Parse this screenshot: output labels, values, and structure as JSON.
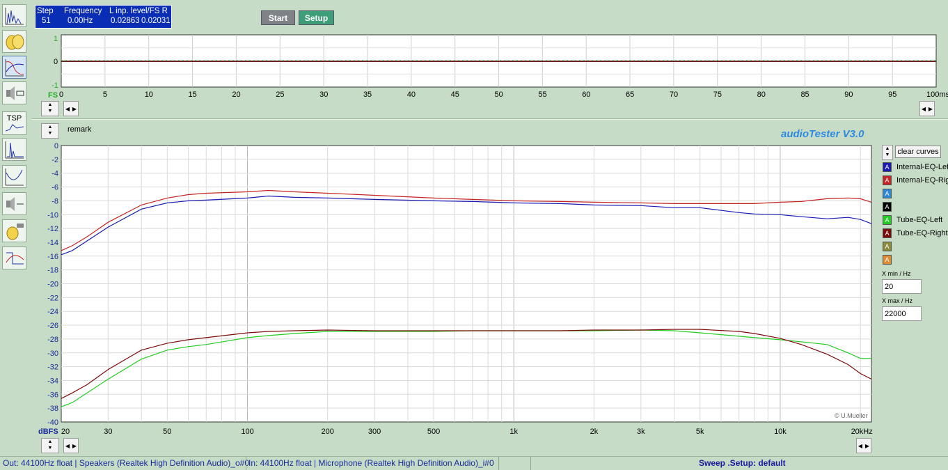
{
  "app": {
    "name": "audioTester",
    "version_label": "audioTester  V3.0",
    "copyright": "© U.Mueller"
  },
  "toolbar": {
    "tsp_label": "TSP",
    "icons": [
      "spectrum-icon",
      "hands-icon",
      "frequency-response-icon",
      "signal-generator-icon",
      "tsp-icon",
      "impulse-icon",
      "impedance-icon",
      "thd-icon",
      "distortion-icon",
      "filter-response-icon"
    ]
  },
  "status_box": {
    "step_label": "Step",
    "step_value": "51",
    "frequency_label": "Frequency",
    "frequency_value": "0.00Hz",
    "level_label": "L  inp. level/FS  R",
    "level_left": "0.02863",
    "level_right": "0.02031"
  },
  "buttons": {
    "start": "Start",
    "setup": "Setup"
  },
  "top_plot": {
    "y_ticks": [
      "1",
      "0",
      "-1"
    ],
    "y_unit": "FS",
    "x_ticks": [
      "0",
      "5",
      "10",
      "15",
      "20",
      "25",
      "30",
      "35",
      "40",
      "45",
      "50",
      "55",
      "60",
      "65",
      "70",
      "75",
      "80",
      "85",
      "90",
      "95",
      "100ms"
    ]
  },
  "remark_label": "remark",
  "main_plot": {
    "y_unit": "dBFS",
    "y_ticks": [
      "0",
      "-2",
      "-4",
      "-6",
      "-8",
      "-10",
      "-12",
      "-14",
      "-16",
      "-18",
      "-20",
      "-22",
      "-24",
      "-26",
      "-28",
      "-30",
      "-32",
      "-34",
      "-36",
      "-38",
      "-40"
    ],
    "x_ticks": [
      "20",
      "30",
      "50",
      "100",
      "200",
      "300",
      "500",
      "1k",
      "2k",
      "3k",
      "5k",
      "10k",
      "20kHz"
    ]
  },
  "legend": {
    "clear_curves": "clear curves",
    "swatch_glyph": "A",
    "curves": [
      {
        "name": "Internal-EQ-Left",
        "color": "#1b1bb4"
      },
      {
        "name": "Internal-EQ-Right",
        "color": "#c42424"
      },
      {
        "name": "",
        "color": "#2e86d6"
      },
      {
        "name": "",
        "color": "#000000"
      },
      {
        "name": "Tube-EQ-Left",
        "color": "#22cc22"
      },
      {
        "name": "Tube-EQ-Right",
        "color": "#7a0a0a"
      },
      {
        "name": "",
        "color": "#8a8a3a"
      },
      {
        "name": "",
        "color": "#e08a30"
      }
    ],
    "xmin_label": "X min / Hz",
    "xmin_value": "20",
    "xmax_label": "X max / Hz",
    "xmax_value": "22000"
  },
  "chart_data": {
    "type": "line",
    "x_scale": "log",
    "xlim": [
      20,
      22000
    ],
    "ylim": [
      -40,
      0
    ],
    "xlabel": "",
    "ylabel": "dBFS",
    "grid": true,
    "x": [
      20,
      22,
      25,
      30,
      40,
      50,
      60,
      70,
      100,
      120,
      150,
      200,
      300,
      500,
      700,
      1000,
      1500,
      2000,
      3000,
      4000,
      5000,
      7000,
      8000,
      10000,
      12000,
      15000,
      18000,
      20000,
      22000
    ],
    "series": [
      {
        "name": "Internal-EQ-Left",
        "color": "#1b1bb4",
        "values": [
          -15.8,
          -15.2,
          -13.8,
          -11.8,
          -9.2,
          -8.3,
          -8.0,
          -7.9,
          -7.6,
          -7.3,
          -7.5,
          -7.6,
          -7.8,
          -8.0,
          -8.1,
          -8.3,
          -8.4,
          -8.6,
          -8.7,
          -9.0,
          -9.0,
          -9.7,
          -9.9,
          -10.0,
          -10.3,
          -10.6,
          -10.4,
          -10.7,
          -11.3
        ]
      },
      {
        "name": "Internal-EQ-Right",
        "color": "#c42424",
        "values": [
          -15.2,
          -14.5,
          -13.2,
          -11.1,
          -8.6,
          -7.6,
          -7.1,
          -6.9,
          -6.7,
          -6.5,
          -6.7,
          -6.9,
          -7.2,
          -7.6,
          -7.8,
          -8.0,
          -8.1,
          -8.2,
          -8.3,
          -8.4,
          -8.4,
          -8.4,
          -8.4,
          -8.2,
          -8.1,
          -7.7,
          -7.6,
          -7.7,
          -8.2
        ]
      },
      {
        "name": "Tube-EQ-Left",
        "color": "#22cc22",
        "values": [
          -37.8,
          -37.2,
          -35.8,
          -33.8,
          -30.9,
          -29.6,
          -29.1,
          -28.8,
          -27.8,
          -27.5,
          -27.2,
          -26.9,
          -26.9,
          -26.9,
          -26.8,
          -26.8,
          -26.8,
          -26.8,
          -26.7,
          -26.8,
          -27.1,
          -27.6,
          -27.8,
          -28.1,
          -28.4,
          -28.8,
          -30.0,
          -30.8,
          -30.8
        ]
      },
      {
        "name": "Tube-EQ-Right",
        "color": "#7a0a0a",
        "values": [
          -36.6,
          -35.8,
          -34.6,
          -32.4,
          -29.6,
          -28.6,
          -28.1,
          -27.8,
          -27.1,
          -26.9,
          -26.8,
          -26.7,
          -26.8,
          -26.8,
          -26.8,
          -26.8,
          -26.8,
          -26.7,
          -26.7,
          -26.6,
          -26.6,
          -26.9,
          -27.2,
          -27.9,
          -28.8,
          -30.2,
          -31.7,
          -33.0,
          -33.8
        ]
      }
    ]
  },
  "status_bar": {
    "out": "Out: 44100Hz float  | Speakers (Realtek High Definition Audio)_o#0",
    "in": "In: 44100Hz float  | Microphone (Realtek High Definition Audio)_i#0",
    "sweep": "Sweep  .Setup:  default"
  }
}
